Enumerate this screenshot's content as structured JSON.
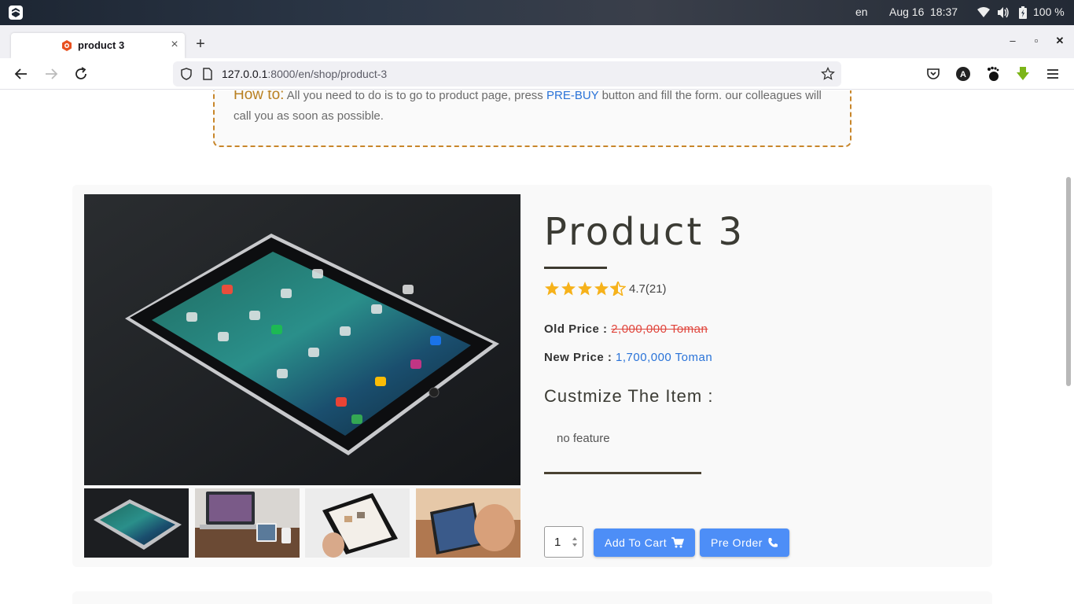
{
  "os": {
    "lang": "en",
    "date": "Aug 16",
    "time": "18:37",
    "battery": "100 %"
  },
  "browser": {
    "tab_title": "product 3",
    "new_tab": "+",
    "tab_close": "×",
    "url_host": "127.0.0.1",
    "url_rest": ":8000/en/shop/product-3",
    "min": "‒",
    "max": "▫",
    "close": "✕"
  },
  "howto": {
    "label": "How to:",
    "text_before": "All you need to do is to go to product page, press",
    "pre_buy": "PRE-BUY",
    "text_after": "button and fill the form. our colleagues will call you as soon as possible."
  },
  "product": {
    "title": "Product 3",
    "rating": "4.7(21)",
    "stars": 4.5,
    "old_price_label": "Old Price :",
    "old_price": "2,000,000 Toman",
    "new_price_label": "New Price :",
    "new_price": "1,700,000 Toman",
    "customize_label": "Custmize The Item :",
    "feature": "no feature",
    "quantity": "1",
    "add_to_cart": "Add To Cart",
    "pre_order": "Pre Order"
  },
  "colors": {
    "accent": "#4d8ef7",
    "star": "#f6b21b",
    "old_price": "#e0453c",
    "new_price": "#2a73d8",
    "howto_border": "#c8862a"
  }
}
